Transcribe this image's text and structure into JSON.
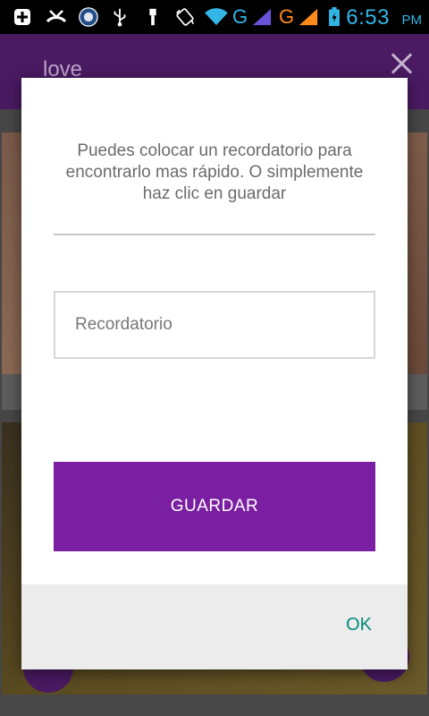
{
  "status_bar": {
    "time": "6:53",
    "ampm": "PM",
    "network_1": "G",
    "network_2": "G",
    "colors": {
      "time": "#33b5e5",
      "network_1": "#33b5e5",
      "network_2": "#ff8a1c"
    },
    "icons": [
      "add-icon",
      "missed-call-icon",
      "app-badge-icon",
      "usb-icon",
      "usb-debug-icon",
      "rotate-icon",
      "wifi-icon",
      "signal-icon",
      "signal-icon",
      "battery-charging-icon"
    ]
  },
  "app_bar": {
    "title": "love",
    "close_icon": "close-icon",
    "color": "#7b1fa2"
  },
  "dialog": {
    "message": "Puedes colocar un recordatorio para encontrarlo mas rápido. O simplemente haz clic en guardar",
    "input": {
      "placeholder": "Recordatorio",
      "value": ""
    },
    "save_label": "GUARDAR",
    "ok_label": "OK",
    "colors": {
      "save_button": "#7b1fa2",
      "ok_text": "#00897b"
    }
  }
}
